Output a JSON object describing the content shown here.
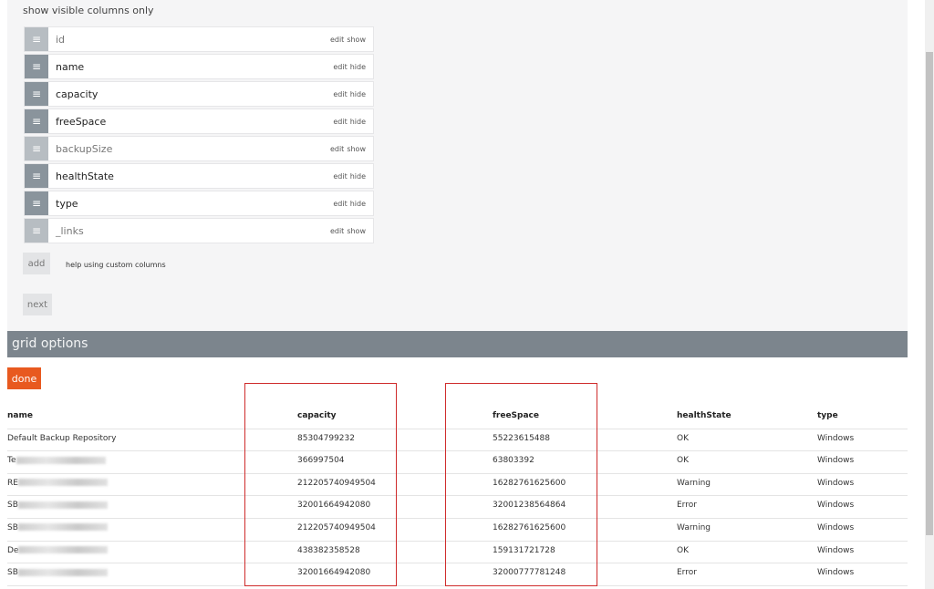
{
  "config": {
    "section_title": "show visible columns only",
    "columns": [
      {
        "name": "id",
        "edit": "edit",
        "toggle": "show",
        "visible": false
      },
      {
        "name": "name",
        "edit": "edit",
        "toggle": "hide",
        "visible": true
      },
      {
        "name": "capacity",
        "edit": "edit",
        "toggle": "hide",
        "visible": true
      },
      {
        "name": "freeSpace",
        "edit": "edit",
        "toggle": "hide",
        "visible": true
      },
      {
        "name": "backupSize",
        "edit": "edit",
        "toggle": "show",
        "visible": false
      },
      {
        "name": "healthState",
        "edit": "edit",
        "toggle": "hide",
        "visible": true
      },
      {
        "name": "type",
        "edit": "edit",
        "toggle": "hide",
        "visible": true
      },
      {
        "name": "_links",
        "edit": "edit",
        "toggle": "show",
        "visible": false
      }
    ],
    "add_label": "add",
    "help_label": "help using custom columns",
    "next_label": "next"
  },
  "grid_options": {
    "title": "grid options",
    "done_label": "done"
  },
  "table": {
    "headers": {
      "name": "name",
      "capacity": "capacity",
      "freeSpace": "freeSpace",
      "healthState": "healthState",
      "type": "type"
    },
    "rows": [
      {
        "name": "Default Backup Repository",
        "name_redacted": false,
        "capacity": "85304799232",
        "freeSpace": "55223615488",
        "healthState": "OK",
        "type": "Windows"
      },
      {
        "name": "Te",
        "name_redacted": true,
        "capacity": "366997504",
        "freeSpace": "63803392",
        "healthState": "OK",
        "type": "Windows"
      },
      {
        "name": "RE",
        "name_redacted": true,
        "capacity": "212205740949504",
        "freeSpace": "16282761625600",
        "healthState": "Warning",
        "type": "Windows"
      },
      {
        "name": "SB",
        "name_redacted": true,
        "capacity": "32001664942080",
        "freeSpace": "32001238564864",
        "healthState": "Error",
        "type": "Windows"
      },
      {
        "name": "SB",
        "name_redacted": true,
        "capacity": "212205740949504",
        "freeSpace": "16282761625600",
        "healthState": "Warning",
        "type": "Windows"
      },
      {
        "name": "De",
        "name_redacted": true,
        "capacity": "438382358528",
        "freeSpace": "159131721728",
        "healthState": "OK",
        "type": "Windows"
      },
      {
        "name": "SB",
        "name_redacted": true,
        "capacity": "32001664942080",
        "freeSpace": "32000777781248",
        "healthState": "Error",
        "type": "Windows"
      }
    ]
  },
  "colors": {
    "accent": "#e8591f",
    "bar": "#7c858d",
    "highlight": "#cf2b2b"
  }
}
